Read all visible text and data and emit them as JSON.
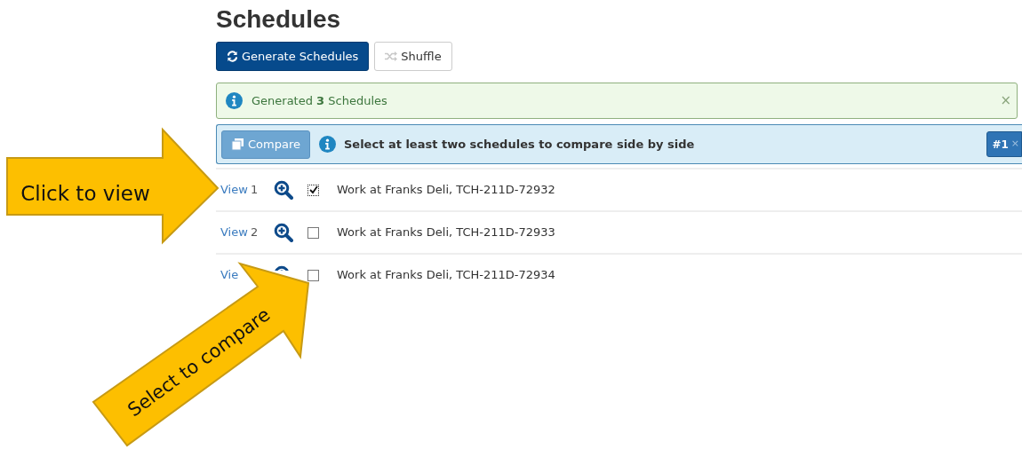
{
  "title": "Schedules",
  "toolbar": [
    {
      "kind": "primary",
      "label": "Generate Schedules"
    },
    {
      "kind": "default",
      "label": "Shuffle"
    }
  ],
  "alert": {
    "text": "Generated **3** Schedules",
    "close": "×"
  },
  "compare_bar": {
    "button": "Compare",
    "disabled": true,
    "message": "Select at least two schedules to compare side by side",
    "badge": "#1",
    "badge_close": "×"
  },
  "schedules": [
    {
      "view": "View",
      "number": "1",
      "checked": true,
      "name": "Work at Franks Deli, TCH-211D-72932"
    },
    {
      "view": "View",
      "number": "2",
      "checked": false,
      "name": "Work at Franks Deli, TCH-211D-72933"
    },
    {
      "view": "Vie",
      "checked": false,
      "name": "Work at Franks Deli, TCH-211D-72934"
    }
  ],
  "callouts": [
    {
      "kind": "right",
      "label": "Click to view"
    },
    {
      "kind": "diagonal",
      "label": "Select to compare"
    }
  ]
}
